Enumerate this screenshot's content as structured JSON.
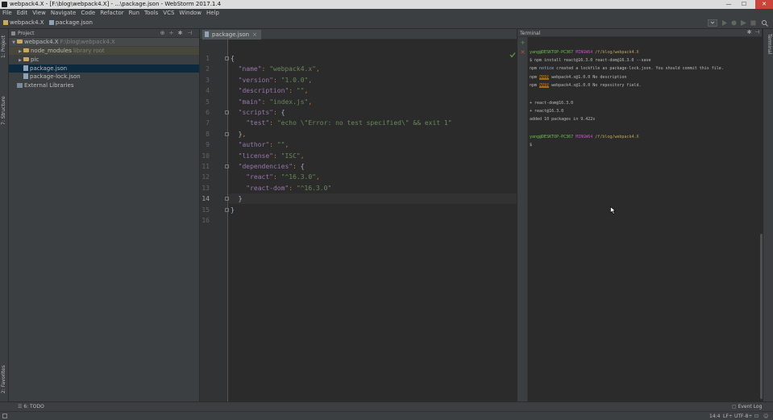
{
  "window": {
    "title": "webpack4.X - [F:\\blog\\webpack4.X] - ...\\package.json - WebStorm 2017.1.4",
    "min": "—",
    "max": "☐",
    "close": "✕"
  },
  "menu": [
    "File",
    "Edit",
    "View",
    "Navigate",
    "Code",
    "Refactor",
    "Run",
    "Tools",
    "VCS",
    "Window",
    "Help"
  ],
  "breadcrumbs": [
    "webpack4.X",
    "package.json"
  ],
  "left_strip": [
    "1: Project",
    "7: Structure",
    "2: Favorites"
  ],
  "project": {
    "header": "Project",
    "tree": [
      {
        "label": "webpack4.X",
        "extra": "F:\\blog\\webpack4.X",
        "level": 0,
        "type": "folder",
        "arrow": "▼"
      },
      {
        "label": "node_modules",
        "extra": "library root",
        "level": 1,
        "type": "folder",
        "arrow": "▶"
      },
      {
        "label": "pic",
        "extra": "",
        "level": 1,
        "type": "folder",
        "arrow": "▶"
      },
      {
        "label": "package.json",
        "extra": "",
        "level": 1,
        "type": "file",
        "arrow": ""
      },
      {
        "label": "package-lock.json",
        "extra": "",
        "level": 1,
        "type": "file",
        "arrow": ""
      },
      {
        "label": "External Libraries",
        "extra": "",
        "level": 0,
        "type": "lib",
        "arrow": ""
      }
    ]
  },
  "editor": {
    "tab": "package.json",
    "current_line": 14,
    "lines": [
      "{",
      "  \"name\": \"webpack4.x\",",
      "  \"version\": \"1.0.0\",",
      "  \"description\": \"\",",
      "  \"main\": \"index.js\",",
      "  \"scripts\": {",
      "    \"test\": \"echo \\\"Error: no test specified\\\" && exit 1\"",
      "  },",
      "  \"author\": \"\",",
      "  \"license\": \"ISC\",",
      "  \"dependencies\": {",
      "    \"react\": \"^16.3.0\",",
      "    \"react-dom\": \"^16.3.0\"",
      "  }",
      "}",
      ""
    ]
  },
  "terminal": {
    "header": "Terminal",
    "prompt1": {
      "user": "yang@DESKTOP-PC367",
      "shell": "MINGW64",
      "path": "/f/blog/webpack4.X"
    },
    "command": "$ npm install react@16.3.0 react-dom@16.3.0 --save",
    "notice": {
      "prefix": "npm",
      "tag": "notice",
      "text": "created a lockfile as package-lock.json. You should commit this file."
    },
    "warn1": {
      "prefix": "npm",
      "tag": "WARN",
      "text": "webpack4.x@1.0.0 No description"
    },
    "warn2": {
      "prefix": "npm",
      "tag": "WARN",
      "text": "webpack4.x@1.0.0 No repository field."
    },
    "out1": "+ react-dom@16.3.0",
    "out2": "+ react@16.3.0",
    "out3": "added 10 packages in 9.422s",
    "prompt2": {
      "user": "yang@DESKTOP-PC367",
      "shell": "MINGW64",
      "path": "/f/blog/webpack4.X"
    },
    "cursor_line": "$"
  },
  "bottom_tool": "6: TODO",
  "event_log": "Event Log",
  "status": {
    "position": "14:4",
    "line_sep": "LF÷",
    "encoding": "UTF-8÷"
  },
  "colors": {
    "bg": "#2b2b2b",
    "panel": "#3c3f41",
    "selection": "#0d293e"
  }
}
